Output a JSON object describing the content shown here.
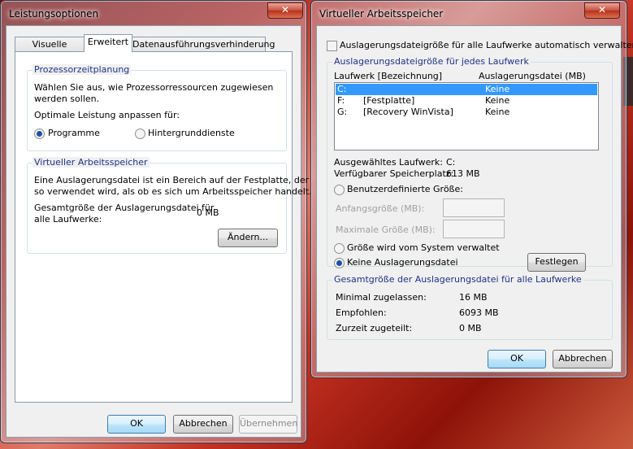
{
  "left_window": {
    "title": "Leistungsoptionen",
    "close": "✕",
    "tabs": [
      "Visuelle Effekte",
      "Erweitert",
      "Datenausführungsverhinderung"
    ],
    "active_tab": "Erweitert",
    "cpu_group": {
      "label": "Prozessorzeitplanung",
      "desc": "Wählen Sie aus, wie Prozessorressourcen zugewiesen werden sollen.",
      "adjust_label": "Optimale Leistung anpassen für:",
      "option_programs": "Programme",
      "option_background": "Hintergrunddienste",
      "selected": "Programme"
    },
    "vm_group": {
      "label": "Virtueller Arbeitsspeicher",
      "desc_line1": "Eine Auslagerungsdatei ist ein Bereich auf der Festplatte, der",
      "desc_line2": "so verwendet wird, als ob es sich um Arbeitsspeicher handelt.",
      "total_label_line1": "Gesamtgröße der Auslagerungsdatei für",
      "total_label_line2": "alle Laufwerke:",
      "total_value": "0 MB",
      "change_button": "Ändern..."
    },
    "buttons": {
      "ok": "OK",
      "cancel": "Abbrechen",
      "apply": "Übernehmen"
    }
  },
  "right_window": {
    "title": "Virtueller Arbeitsspeicher",
    "close": "✕",
    "auto_manage_label": "Auslagerungsdateigröße für alle Laufwerke automatisch verwalten",
    "auto_manage_checked": false,
    "drives_group": {
      "label": "Auslagerungsdateigröße für jedes Laufwerk",
      "col_drive": "Laufwerk [Bezeichnung]",
      "col_pagefile": "Auslagerungsdatei (MB)",
      "drives": [
        {
          "letter": "C:",
          "label": "",
          "pagefile": "Keine",
          "selected": true
        },
        {
          "letter": "F:",
          "label": "[Festplatte]",
          "pagefile": "Keine",
          "selected": false
        },
        {
          "letter": "G:",
          "label": "[Recovery WinVista]",
          "pagefile": "Keine",
          "selected": false
        }
      ],
      "selected_drive_label": "Ausgewähltes Laufwerk:",
      "selected_drive_value": "C:",
      "free_space_label": "Verfügbarer Speicherplatz:",
      "free_space_value": "613 MB",
      "opt_custom": "Benutzerdefinierte Größe:",
      "initial_label": "Anfangsgröße (MB):",
      "max_label": "Maximale Größe (MB):",
      "opt_system": "Größe wird vom System verwaltet",
      "opt_none": "Keine Auslagerungsdatei",
      "selected_option": "Keine Auslagerungsdatei",
      "set_button": "Festlegen"
    },
    "total_group": {
      "label": "Gesamtgröße der Auslagerungsdatei für alle Laufwerke",
      "min_label": "Minimal zugelassen:",
      "min_value": "16 MB",
      "rec_label": "Empfohlen:",
      "rec_value": "6093 MB",
      "cur_label": "Zurzeit zugeteilt:",
      "cur_value": "0 MB"
    },
    "buttons": {
      "ok": "OK",
      "cancel": "Abbrechen"
    }
  },
  "colors": {
    "selection": "#3399ff",
    "group_label": "#1e3287",
    "close_button": "#c74f3c"
  }
}
